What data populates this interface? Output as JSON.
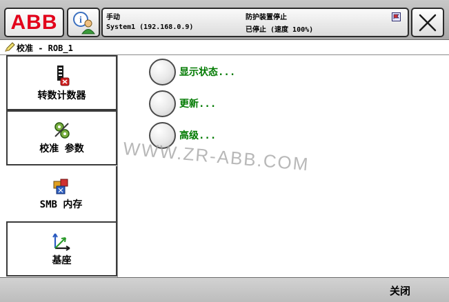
{
  "topbar": {
    "logo_text": "ABB",
    "status": {
      "mode": "手动",
      "system": "System1 (192.168.0.9)",
      "protection": "防护装置停止",
      "state": "已停止 (速度 100%)"
    }
  },
  "titlebar": {
    "title": "校准 - ROB_1",
    "icon": "pencil-icon"
  },
  "nav": {
    "items": [
      {
        "label": "转数计数器",
        "icon": "rev-counter-icon"
      },
      {
        "label": "校准 参数",
        "icon": "calibration-params-icon"
      },
      {
        "label": "SMB 内存",
        "icon": "smb-memory-icon",
        "selected": true
      },
      {
        "label": "基座",
        "icon": "base-frame-icon"
      }
    ]
  },
  "options": [
    {
      "label": "显示状态..."
    },
    {
      "label": "更新..."
    },
    {
      "label": "高级..."
    }
  ],
  "watermark": "WWW.ZR-ABB.COM",
  "bottombar": {
    "close_label": "关闭"
  },
  "colors": {
    "brand_red": "#e2001a",
    "option_green": "#007a00",
    "bar_gray": "#c0c0c0"
  }
}
